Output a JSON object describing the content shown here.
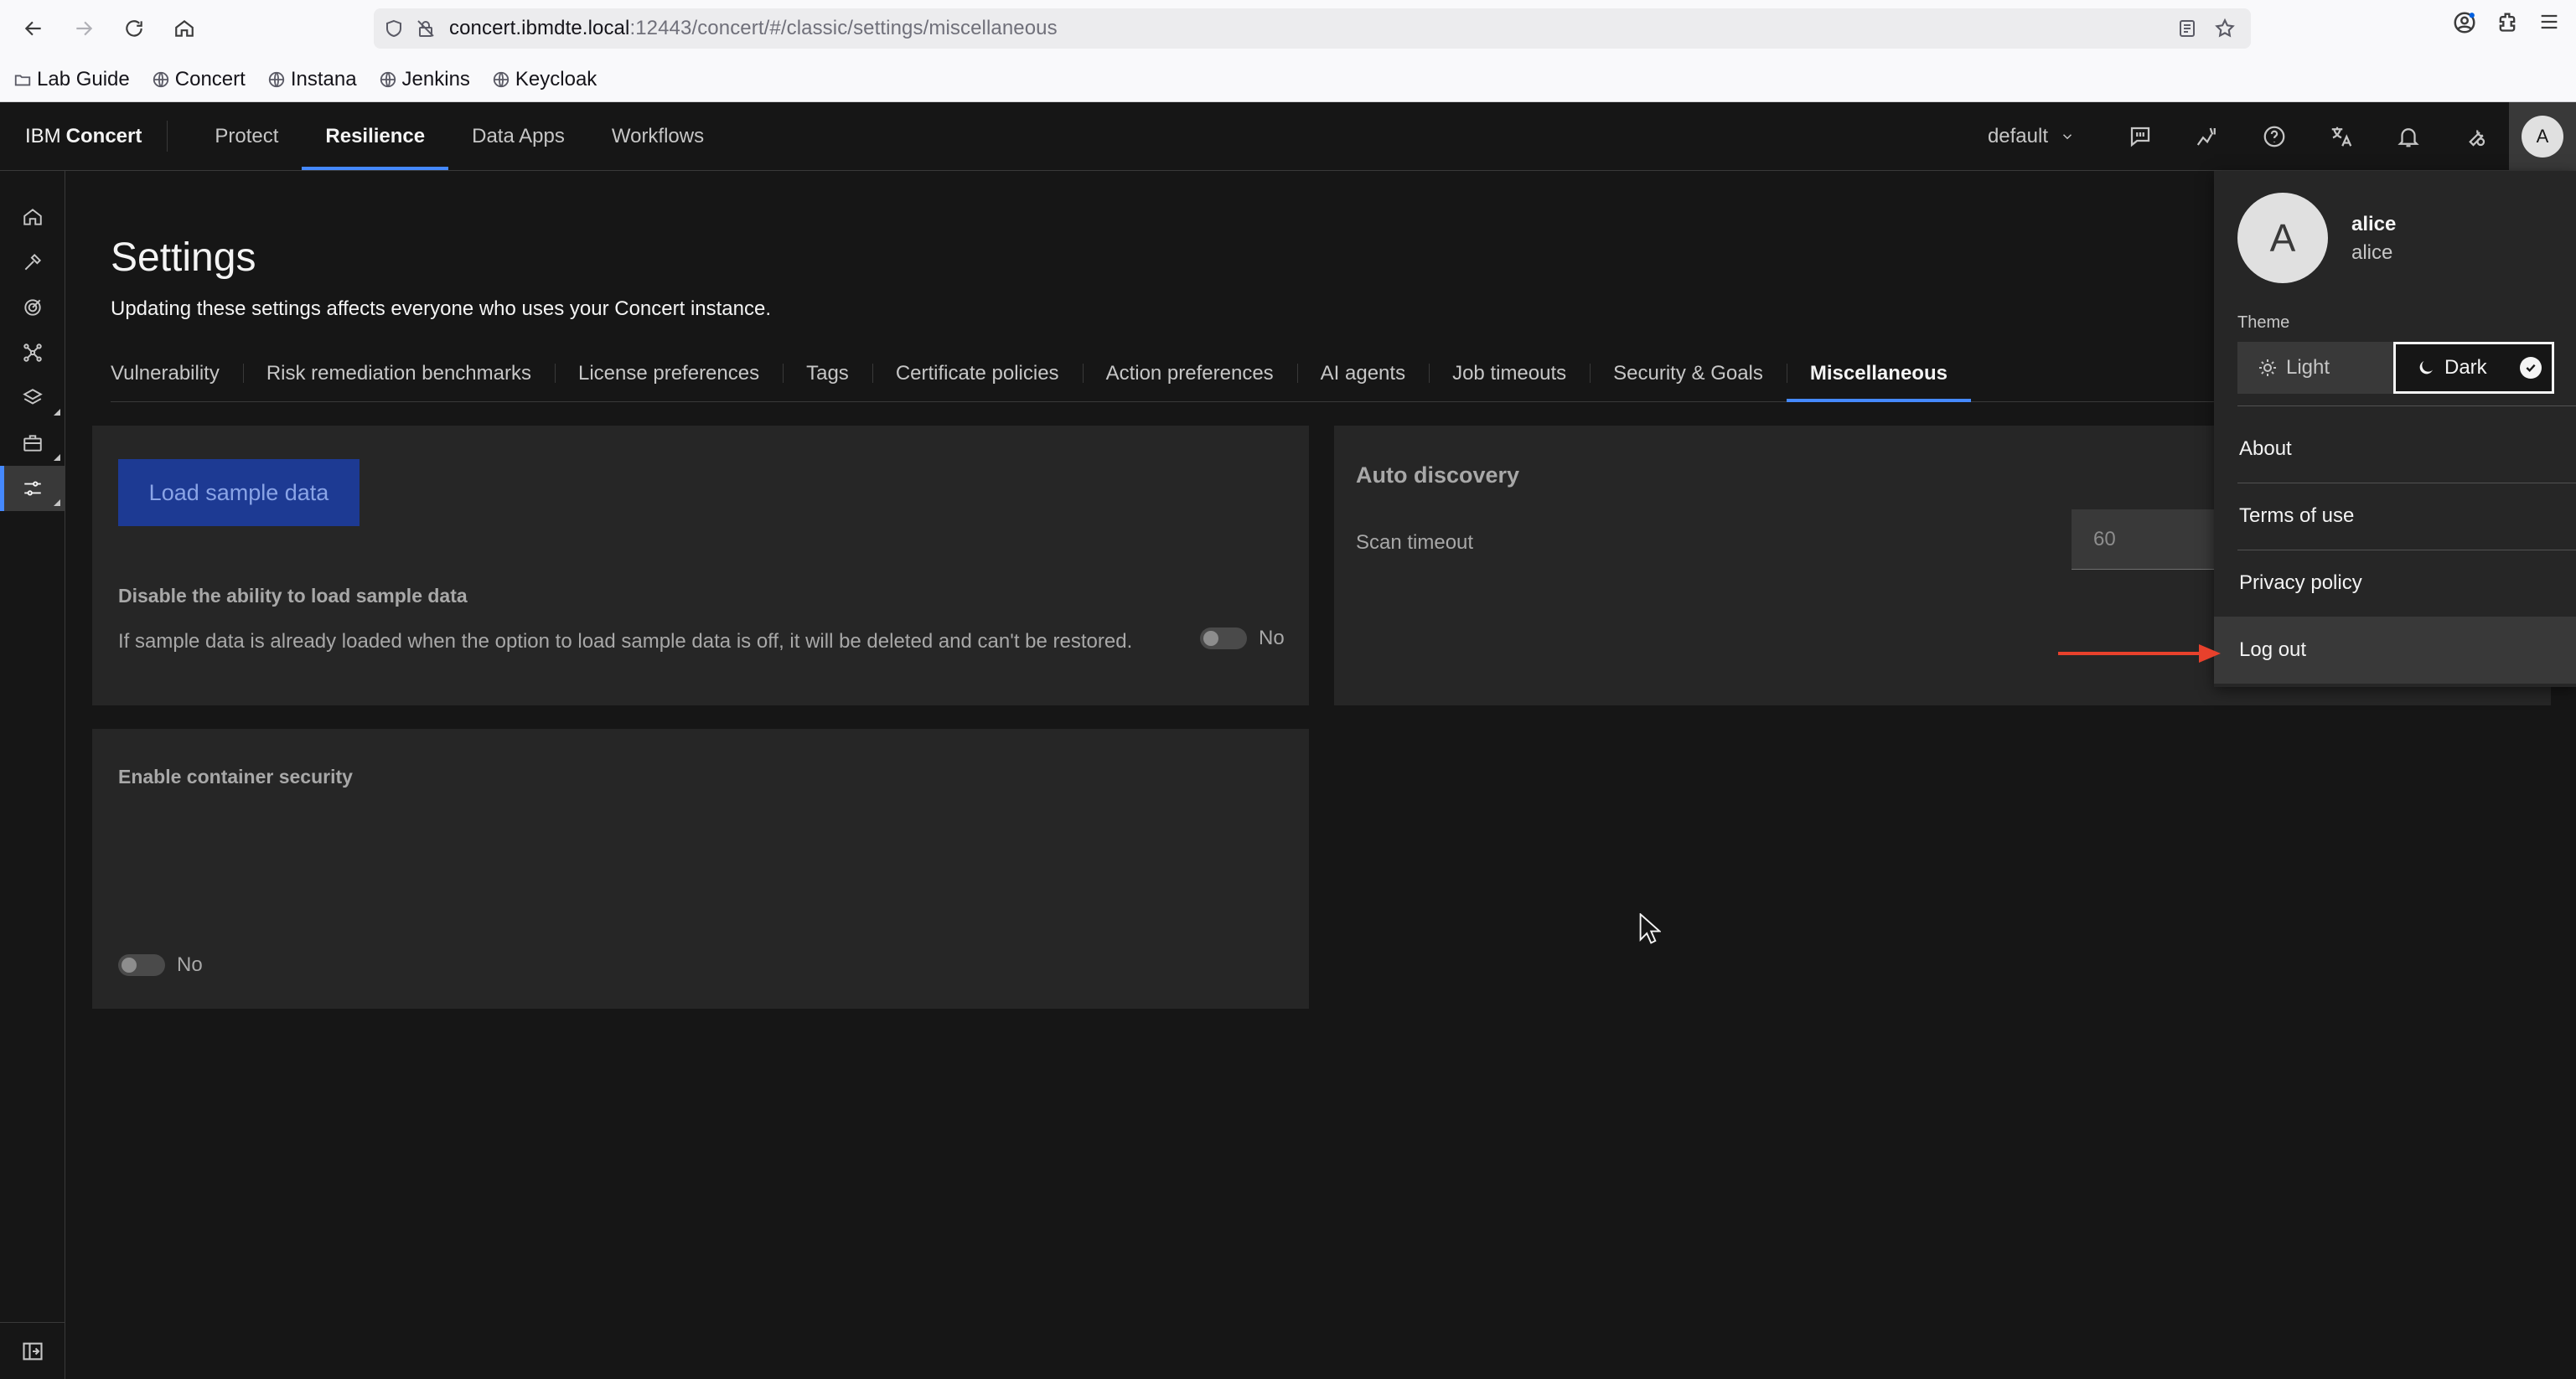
{
  "browser": {
    "url_host": "concert.ibmdte.local",
    "url_rest": ":12443/concert/#/classic/settings/miscellaneous",
    "bookmarks": [
      {
        "label": "Lab Guide"
      },
      {
        "label": "Concert"
      },
      {
        "label": "Instana"
      },
      {
        "label": "Jenkins"
      },
      {
        "label": "Keycloak"
      }
    ]
  },
  "header": {
    "brand_prefix": "IBM",
    "brand_name": "Concert",
    "nav": [
      {
        "label": "Protect",
        "active": false
      },
      {
        "label": "Resilience",
        "active": true
      },
      {
        "label": "Data Apps",
        "active": false
      },
      {
        "label": "Workflows",
        "active": false
      }
    ],
    "workspace": "default",
    "avatar_initial": "A"
  },
  "page": {
    "title": "Settings",
    "description": "Updating these settings affects everyone who uses your Concert instance.",
    "tabs": [
      {
        "label": "Vulnerability",
        "active": false
      },
      {
        "label": "Risk remediation benchmarks",
        "active": false
      },
      {
        "label": "License preferences",
        "active": false
      },
      {
        "label": "Tags",
        "active": false
      },
      {
        "label": "Certificate policies",
        "active": false
      },
      {
        "label": "Action preferences",
        "active": false
      },
      {
        "label": "AI agents",
        "active": false
      },
      {
        "label": "Job timeouts",
        "active": false
      },
      {
        "label": "Security & Goals",
        "active": false
      },
      {
        "label": "Miscellaneous",
        "active": true
      }
    ]
  },
  "tiles": {
    "sample": {
      "button_label": "Load sample data",
      "label": "Disable the ability to load sample data",
      "description": "If sample data is already loaded when the option to load sample data is off, it will be deleted and can't be restored.",
      "toggle_text": "No"
    },
    "discovery": {
      "title": "Auto discovery",
      "scan_label": "Scan timeout",
      "scan_value": "60"
    },
    "container": {
      "label": "Enable container security",
      "toggle_text": "No"
    }
  },
  "profile": {
    "initial": "A",
    "name": "alice",
    "username": "alice",
    "theme_label": "Theme",
    "theme_light": "Light",
    "theme_dark": "Dark",
    "menu": [
      {
        "label": "About"
      },
      {
        "label": "Terms of use"
      },
      {
        "label": "Privacy policy"
      },
      {
        "label": "Log out"
      }
    ]
  },
  "colors": {
    "accent": "#4589ff",
    "annotation_arrow": "#e8412c",
    "primary_button": "#1d3a93"
  }
}
